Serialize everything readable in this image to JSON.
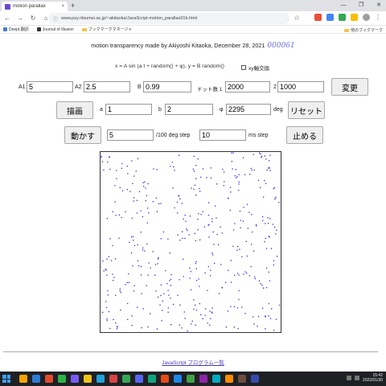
{
  "browser": {
    "tab_title": "motion parallax",
    "tab_close": "×",
    "new_tab": "+",
    "url": "www.psy.ritsumei.ac.jp/~akitaoka/JavaScript-motion_parallax01b.html",
    "lock": "ⓘ",
    "star": "☆",
    "win_min": "—",
    "win_max": "❐",
    "win_close": "✕",
    "back": "←",
    "forward": "→",
    "reload": "↻",
    "home": "⌂",
    "bookmarks": [
      "DeepL翻訳",
      "Journal of Illusion",
      "ブックマークマネージャ"
    ],
    "other_bookmarks": "他のブックマーク"
  },
  "page": {
    "credit": "motion transparency made by Akiyoshi Kitaoka, December 28, 2021",
    "counter": "000061",
    "formula": "x = A sin (a t + random() + φ), y = B random()",
    "swap_label": "xy軸交換",
    "fields": {
      "A1_label": "A1",
      "A1": "5",
      "A2_label": "A2",
      "A2": "2.5",
      "B_label": "B",
      "B": "0.99",
      "dots1_label": "ドット数 1",
      "dots1": "2000",
      "dots2_label": "2",
      "dots2": "1000",
      "a_label": "a",
      "a": "1",
      "b_label": "b",
      "b": "2",
      "phi_label": "φ",
      "phi": "2295",
      "phi_unit": "deg",
      "step": "5",
      "step_unit": "/100 deg step",
      "ms": "10",
      "ms_unit": "ms step"
    },
    "buttons": {
      "swap": "変更",
      "draw": "描画",
      "reset": "リセット",
      "move": "動かす",
      "stop": "止める"
    },
    "footer_link": "JavaScript プログラム一覧"
  },
  "canvas": {
    "dot_color": "#2a2ae6",
    "seed": 61
  },
  "taskbar": {
    "time": "15:42",
    "date": "2022/01/30",
    "app_colors": [
      "#f4a300",
      "#2e7cd6",
      "#e24a2f",
      "#2db34a",
      "#7a5af5",
      "#f0c419",
      "#22a3dc",
      "#d84343",
      "#3aa655",
      "#5865f2",
      "#10a37f",
      "#e64a19",
      "#1e88e5",
      "#43a047",
      "#8e24aa",
      "#00acc1",
      "#fb8c00",
      "#6d4c41",
      "#3949ab"
    ]
  }
}
